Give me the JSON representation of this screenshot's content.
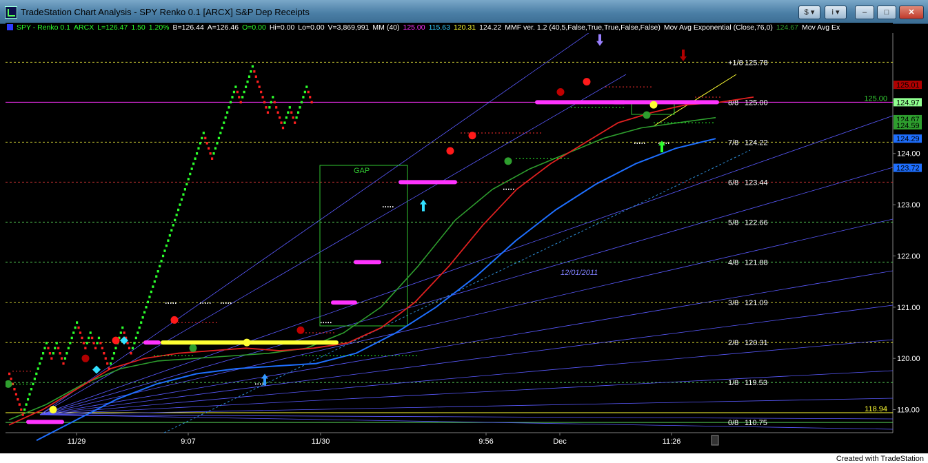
{
  "window": {
    "title": "TradeStation Chart Analysis - SPY Renko 0.1 [ARCX] S&P Dep Receipts",
    "buttons": [
      "$",
      "i",
      "–",
      "□",
      "✕"
    ]
  },
  "infobar": [
    {
      "text": "SPY - Renko 0.1",
      "color": "#2cff2c"
    },
    {
      "text": "ARCX",
      "color": "#2cff2c"
    },
    {
      "text": "L=126.47",
      "color": "#2cff2c"
    },
    {
      "text": "1.50",
      "color": "#2cff2c"
    },
    {
      "text": "1.20%",
      "color": "#2cff2c"
    },
    {
      "text": "B=126.44",
      "color": "#ffffff"
    },
    {
      "text": "A=126.46",
      "color": "#ffffff"
    },
    {
      "text": "O=0.00",
      "color": "#2cff2c"
    },
    {
      "text": "Hi=0.00",
      "color": "#ffffff"
    },
    {
      "text": "Lo=0.00",
      "color": "#ffffff"
    },
    {
      "text": "V=3,869,991",
      "color": "#ffffff"
    },
    {
      "text": "MM (40)",
      "color": "#ffffff"
    },
    {
      "text": "125.00",
      "color": "#ff33ff"
    },
    {
      "text": "115.63",
      "color": "#33ccff"
    },
    {
      "text": "120.31",
      "color": "#ffff33"
    },
    {
      "text": "124.22",
      "color": "#ffffff"
    },
    {
      "text": "MMF ver. 1.2 (40,5,False,True,True,False,False)",
      "color": "#ffffff"
    },
    {
      "text": "Mov Avg Exponential (Close,76,0)",
      "color": "#ffffff"
    },
    {
      "text": "124.67",
      "color": "#2e9e2e"
    },
    {
      "text": "Mov Avg Ex",
      "color": "#ffffff"
    }
  ],
  "chart_data": {
    "type": "renko",
    "ylim": [
      118.55,
      126.35
    ],
    "x_tick_labels": [
      "11/29",
      "9:07",
      "11/30",
      "9:56",
      "Dec",
      "11:26"
    ],
    "y_tick_labels": [
      "119.00",
      "120.00",
      "121.00",
      "122.00",
      "123.00",
      "124.00"
    ],
    "murrey_levels": [
      {
        "label": "+1/8",
        "value": 125.78
      },
      {
        "label": "8/8",
        "value": 125.0
      },
      {
        "label": "7/8",
        "value": 124.22
      },
      {
        "label": "6/8",
        "value": 123.44
      },
      {
        "label": "5/8",
        "value": 122.66
      },
      {
        "label": "4/8",
        "value": 121.88
      },
      {
        "label": "3/8",
        "value": 121.09
      },
      {
        "label": "2/8",
        "value": 120.31
      },
      {
        "label": "1/8",
        "value": 119.53
      },
      {
        "label": "0/8",
        "value": 118.75
      }
    ],
    "murrey_value_labels": [
      "125.78",
      "125.00",
      "124.22",
      "123.44",
      "122.66",
      "121.88",
      "121.09",
      "120.31",
      "119.53",
      "110.75"
    ],
    "renko_path": [
      119.8,
      119.3,
      118.9,
      119.2,
      119.9,
      120.3,
      120.0,
      120.3,
      119.9,
      120.3,
      120.7,
      120.2,
      120.5,
      120.2,
      120.4,
      120.0,
      119.9,
      119.8,
      120.2,
      120.6,
      120.1,
      120.3,
      120.9,
      121.6,
      122.4,
      123.0,
      123.4,
      123.8,
      124.3,
      124.4,
      124.0,
      123.9,
      124.3,
      124.9,
      125.3,
      125.0,
      125.3,
      125.7,
      125.3,
      124.8,
      125.1,
      124.5,
      124.9,
      124.6,
      125.1,
      125.3,
      125.0
    ],
    "ema_red": [
      118.7,
      119.0,
      119.4,
      119.8,
      120.0,
      120.1,
      120.15,
      120.2,
      120.15,
      120.2,
      120.3,
      120.6,
      121.1,
      121.8,
      122.6,
      123.3,
      123.8,
      124.2,
      124.6,
      124.8,
      124.95,
      125.0,
      125.1
    ],
    "ema_green": [
      118.8,
      119.1,
      119.5,
      119.8,
      119.95,
      120.0,
      120.05,
      120.1,
      120.2,
      120.5,
      121.0,
      121.8,
      122.7,
      123.3,
      123.7,
      124.0,
      124.3,
      124.5,
      124.6,
      124.7
    ],
    "ema_blue": [
      118.4,
      118.8,
      119.2,
      119.5,
      119.7,
      119.8,
      119.85,
      119.9,
      120.1,
      120.5,
      121.0,
      121.6,
      122.3,
      122.9,
      123.4,
      123.8,
      124.1,
      124.29
    ],
    "value_tags": [
      {
        "text": "125.00",
        "value": 125.0,
        "color": "#32c832"
      },
      {
        "text": "118.94",
        "value": 118.94,
        "color": "#ffff33"
      }
    ],
    "axis_tags": [
      {
        "text": "125.01",
        "value": 125.34,
        "color": "#b00000"
      },
      {
        "text": "124.97",
        "value": 125.0,
        "color": "#90ff90"
      },
      {
        "text": "124.67",
        "value": 124.67,
        "color": "#2e9e2e"
      },
      {
        "text": "124.59",
        "value": 124.55,
        "color": "#2e9e2e"
      },
      {
        "text": "124.29",
        "value": 124.29,
        "color": "#1e6fff"
      },
      {
        "text": "123.72",
        "value": 123.72,
        "color": "#1e6fff"
      }
    ],
    "annotations": {
      "gap_label": "GAP",
      "date_label": "12/01/2011"
    }
  },
  "footer": {
    "text": "Created with TradeStation"
  }
}
